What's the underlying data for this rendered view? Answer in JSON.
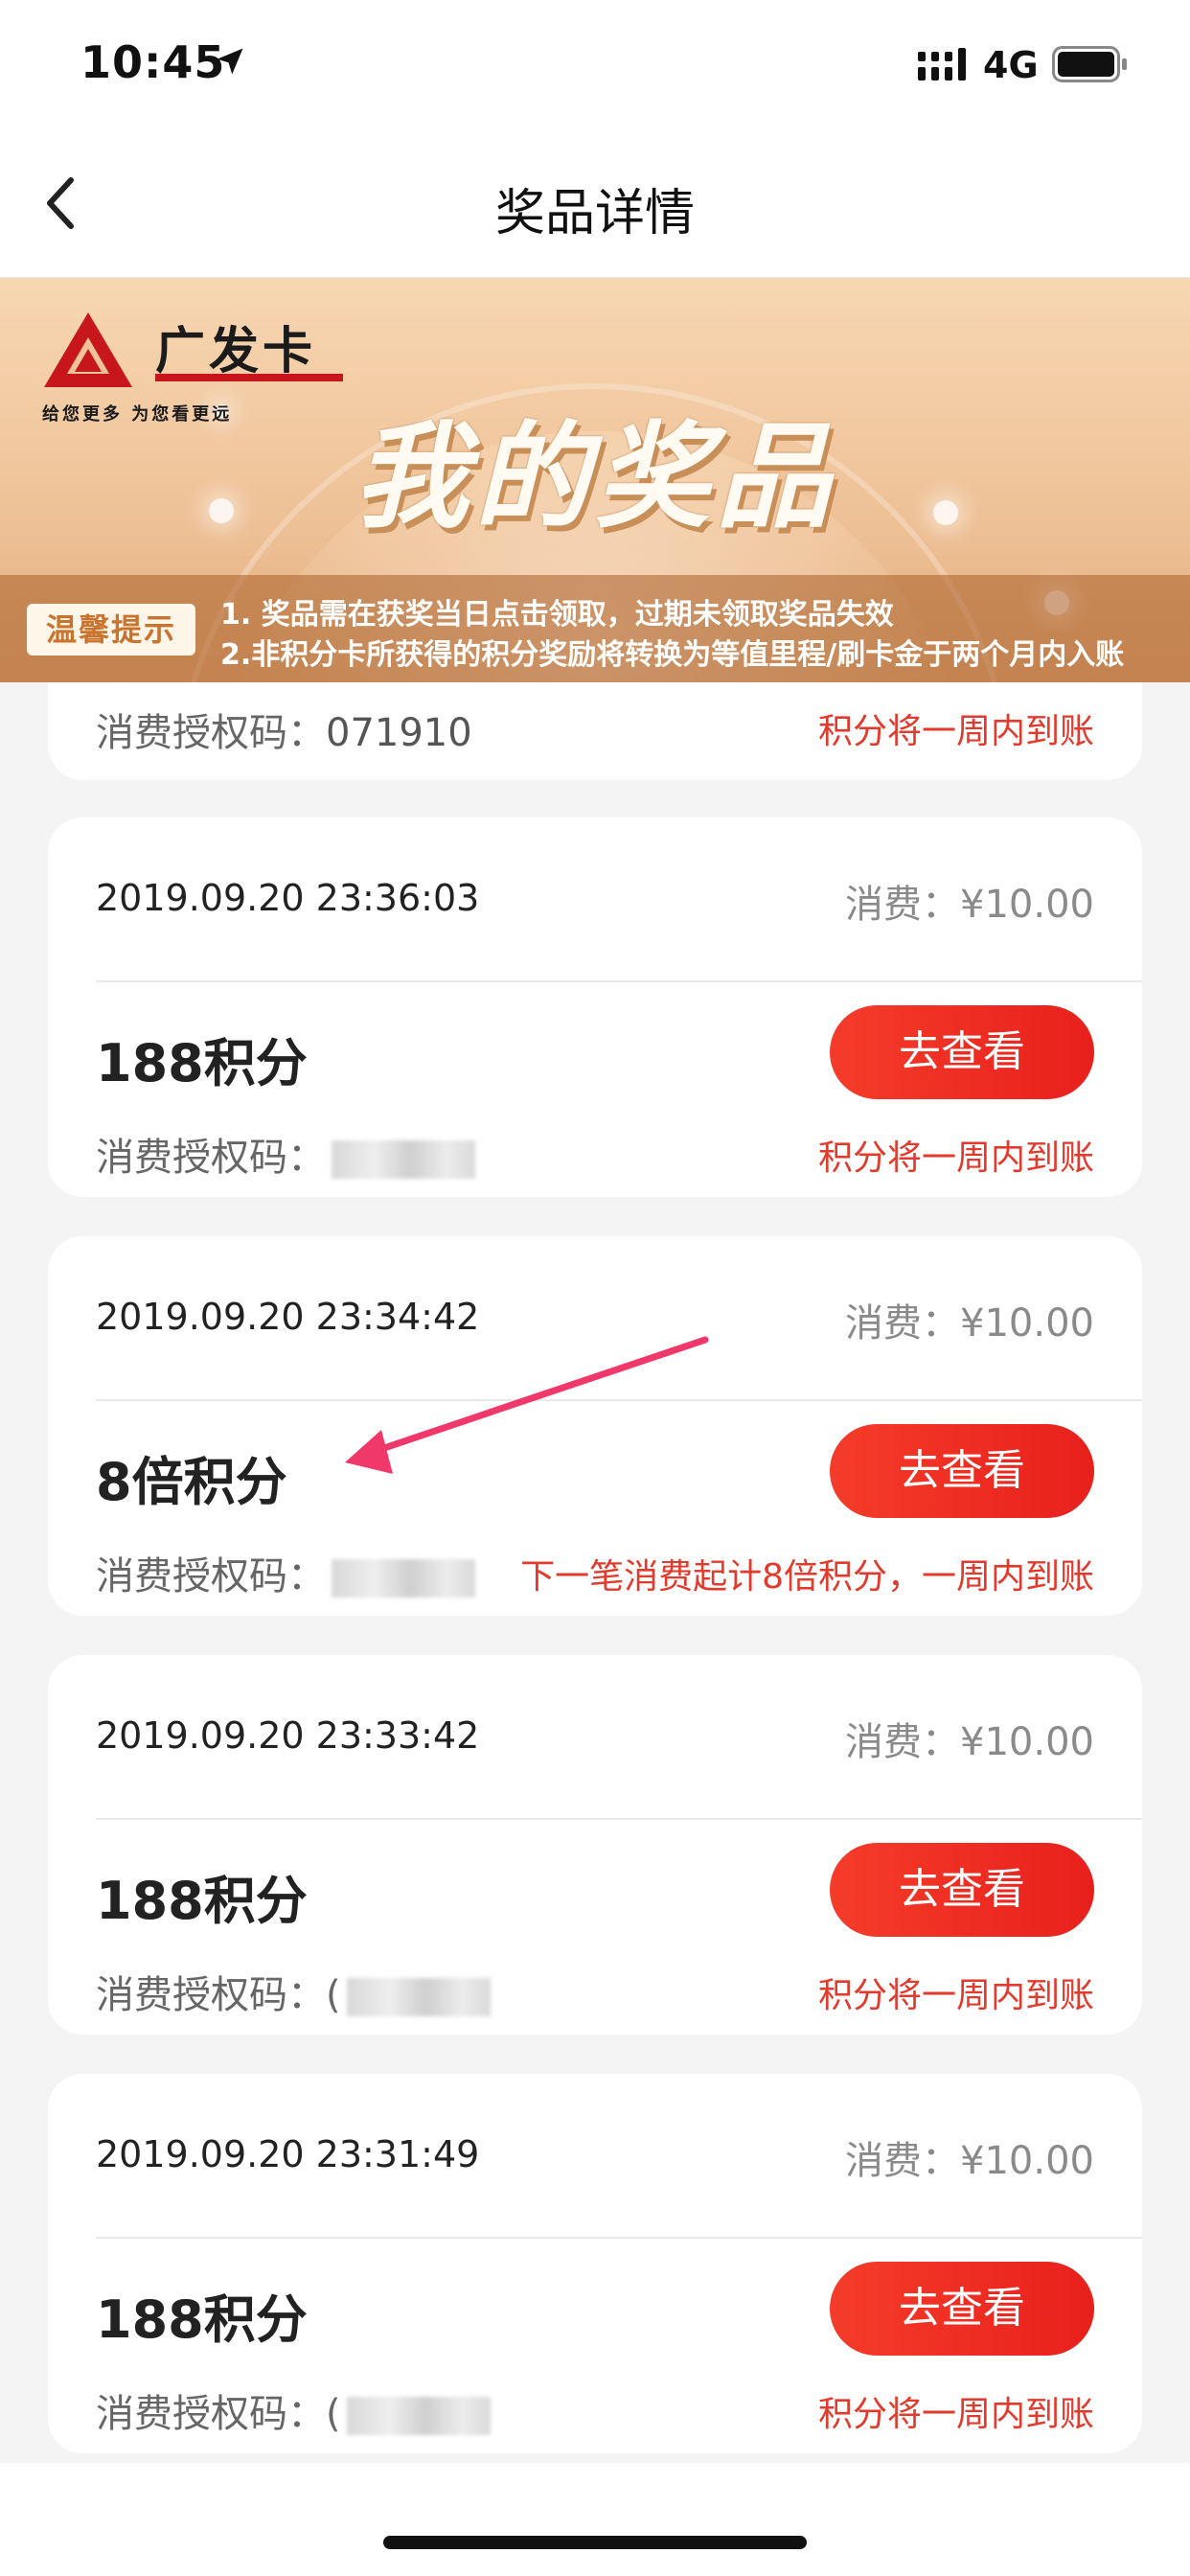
{
  "status_bar": {
    "time": "10:45",
    "network": "4G",
    "icons": [
      "location-arrow-icon",
      "signal-icon",
      "battery-icon"
    ]
  },
  "nav": {
    "title": "奖品详情",
    "back_icon": "chevron-left-icon"
  },
  "banner": {
    "brand_name": "广发卡",
    "brand_slogan": "给您更多   为您看更远",
    "title": "我的奖品",
    "tip_badge": "温馨提示",
    "tip_lines": [
      "1. 奖品需在获奖当日点击领取，过期未领取奖品失效",
      "2.非积分卡所获得的积分奖励将转换为等值里程/刷卡金于两个月内入账"
    ],
    "colors": {
      "brand_red": "#c8161d",
      "banner_gold": "#efc399"
    }
  },
  "partial_card": {
    "code_label": "消费授权码：",
    "code_value": "071910",
    "note": "积分将一周内到账"
  },
  "cards": [
    {
      "time": "2019.09.20 23:36:03",
      "fee_label": "消费：",
      "fee": "¥10.00",
      "prize": "188积分",
      "button": "去查看",
      "code_label": "消费授权码：",
      "note": "积分将一周内到账"
    },
    {
      "time": "2019.09.20 23:34:42",
      "fee_label": "消费：",
      "fee": "¥10.00",
      "prize": "8倍积分",
      "button": "去查看",
      "code_label": "消费授权码：",
      "note": "下一笔消费起计8倍积分，一周内到账"
    },
    {
      "time": "2019.09.20 23:33:42",
      "fee_label": "消费：",
      "fee": "¥10.00",
      "prize": "188积分",
      "button": "去查看",
      "code_label": "消费授权码：(",
      "note": "积分将一周内到账"
    },
    {
      "time": "2019.09.20 23:31:49",
      "fee_label": "消费：",
      "fee": "¥10.00",
      "prize": "188积分",
      "button": "去查看",
      "code_label": "消费授权码：(",
      "note": "积分将一周内到账"
    }
  ],
  "colors": {
    "accent_red": "#e8201c",
    "note_red": "#e23a2c",
    "annotation_pink": "#f0386b"
  }
}
